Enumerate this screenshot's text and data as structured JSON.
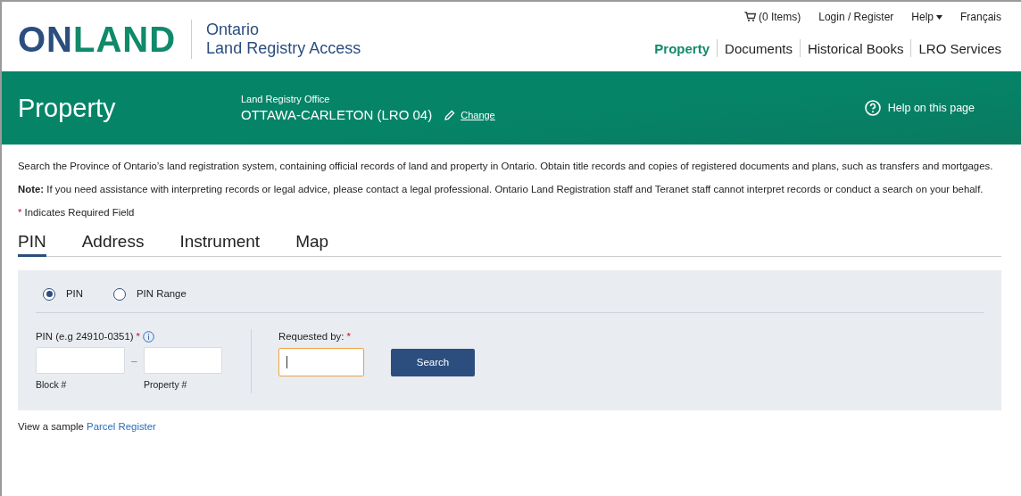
{
  "logo": {
    "part_1": "ON",
    "part_2": "LAND",
    "subtitle_1": "Ontario",
    "subtitle_2": "Land Registry Access"
  },
  "utility_links": [
    {
      "kind": "cart",
      "label": "(0 Items)"
    },
    {
      "kind": "link",
      "label": "Login / Register"
    },
    {
      "kind": "menu",
      "label": "Help"
    },
    {
      "kind": "link",
      "label": "Français"
    }
  ],
  "nav": [
    {
      "label": "Property",
      "selected": true
    },
    {
      "label": "Documents",
      "selected": false
    },
    {
      "label": "Historical Books",
      "selected": false
    },
    {
      "label": "LRO Services",
      "selected": false
    }
  ],
  "banner": {
    "title": "Property",
    "office_label": "Land Registry Office",
    "office": "OTTAWA-CARLETON (LRO 04)",
    "change_link": "Change",
    "help_link": "Help on this page"
  },
  "intro": "Search the Province of Ontario’s land registration system, containing official records of land and property in Ontario. Obtain title records and copies of registered documents and plans, such as transfers and mortgages.",
  "note": "**Note:** If you need assistance with interpreting records or legal advice, please contact a legal professional. Ontario Land Registration staff and Teranet staff cannot interpret records or conduct a search on your behalf.",
  "required_note": {
    "mark": "*",
    "text": "Indicates Required Field"
  },
  "tabs": [
    {
      "label": "PIN",
      "selected": true
    },
    {
      "label": "Address",
      "selected": false
    },
    {
      "label": "Instrument",
      "selected": false
    },
    {
      "label": "Map",
      "selected": false
    }
  ],
  "search_type": [
    {
      "label": "PIN",
      "selected": true
    },
    {
      "label": "PIN Range",
      "selected": false
    }
  ],
  "pin_field": {
    "label": "PIN (e.g 24910-0351)",
    "required_mark": "*",
    "separator": "–",
    "block_label": "Block #",
    "property_label": "Property #"
  },
  "requested_by": {
    "label": "Requested by:",
    "required_mark": "*",
    "focused": true
  },
  "search_button": "Search",
  "sample": {
    "text": "View a sample",
    "link": "Parcel Register"
  }
}
